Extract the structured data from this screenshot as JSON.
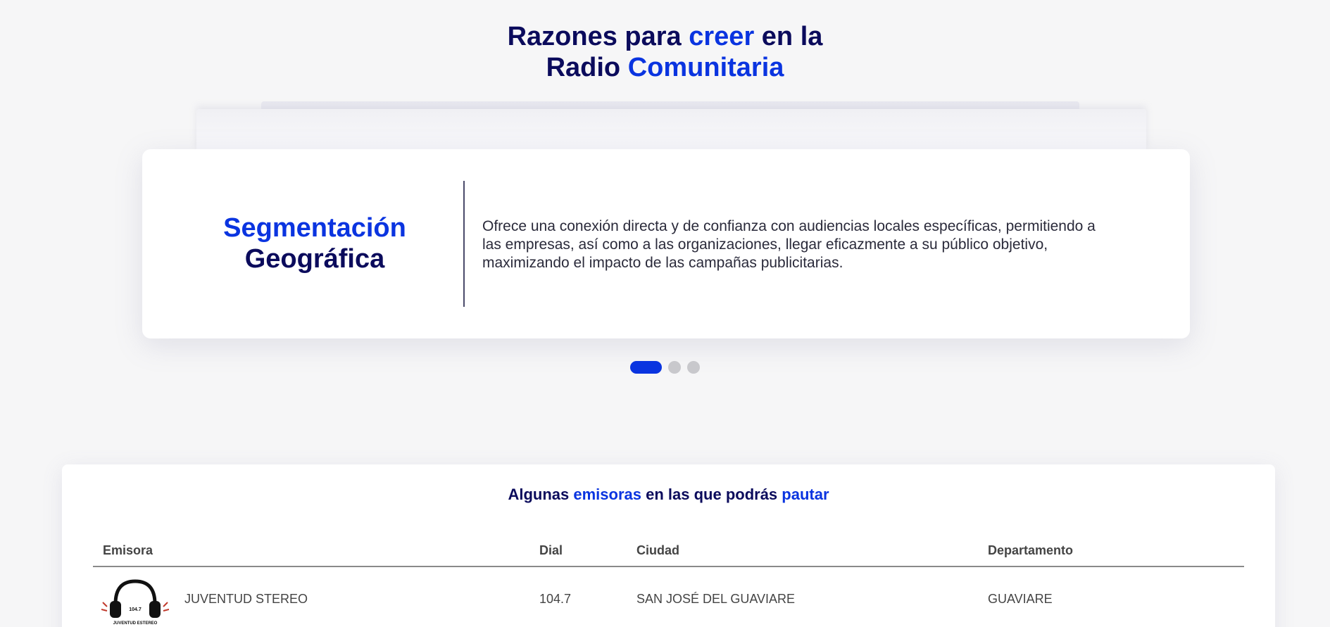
{
  "hero": {
    "line1_a": "Razones para ",
    "line1_b": "creer",
    "line1_c": " en la",
    "line2_a": "Radio ",
    "line2_b": "Comunitaria"
  },
  "carousel": {
    "card_title_line1": "Segmentación",
    "card_title_line2": "Geográfica",
    "card_text": "Ofrece una conexión directa y de confianza con audiencias locales específicas, permitiendo a las empresas, así como a las organizaciones, llegar eficazmente a su público objetivo, maximizando el impacto de las campañas publicitarias.",
    "total_slides": 3,
    "active_slide": 1
  },
  "stations": {
    "title_a": "Algunas ",
    "title_b": "emisoras",
    "title_c": " en las que podrás ",
    "title_d": "pautar",
    "headers": {
      "emisora": "Emisora",
      "dial": "Dial",
      "ciudad": "Ciudad",
      "departamento": "Departamento"
    },
    "rows": [
      {
        "logo_text": "104.7",
        "logo_caption": "JUVENTUD ESTEREO",
        "emisora": "JUVENTUD STEREO",
        "dial": "104.7",
        "ciudad": "SAN JOSÉ DEL GUAVIARE",
        "departamento": "GUAVIARE"
      }
    ]
  },
  "colors": {
    "accent": "#0a34e0",
    "navy": "#0b0b5c",
    "background": "#f6f6f7"
  }
}
